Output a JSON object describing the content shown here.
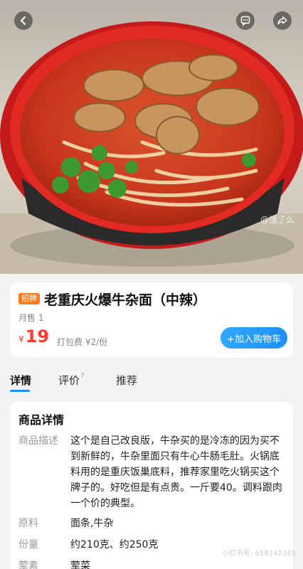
{
  "nav": {
    "back_icon": "chevron-left-icon",
    "message_icon": "message-icon",
    "share_icon": "share-icon"
  },
  "hero": {
    "alt": "老重庆火爆牛杂面",
    "watermark": "@饿了么"
  },
  "product": {
    "badge": "招牌",
    "title": "老重庆火爆牛杂面（中辣）",
    "sold": "月售 1",
    "currency": "¥",
    "price": "19",
    "packing_fee": "打包费 ¥2/份",
    "add_to_cart": "+加入购物车"
  },
  "tabs": [
    {
      "label": "详情",
      "active": true
    },
    {
      "label": "评价",
      "count": "7"
    },
    {
      "label": "推荐"
    }
  ],
  "details": {
    "title": "商品详情",
    "rows": [
      {
        "label": "商品描述",
        "value": "这个是自己改良版，牛杂买的是冷冻的因为买不到新鲜的，牛杂里面只有牛心牛肠毛肚。火锅底料用的是重庆饭巢底料，推荐家里吃火锅买这个牌子的。好吃但是有点贵。一斤要40。调料跟肉一个价的典型。"
      },
      {
        "label": "原料",
        "value": "面条,牛杂"
      },
      {
        "label": "份量",
        "value": "约210克、约250克"
      },
      {
        "label": "荤素",
        "value": "荤菜"
      }
    ],
    "watermark": "小红书号: 658142345"
  },
  "colors": {
    "accent": "#1e90ff",
    "price": "#ff3b30",
    "badge": "#ff7a1a"
  }
}
